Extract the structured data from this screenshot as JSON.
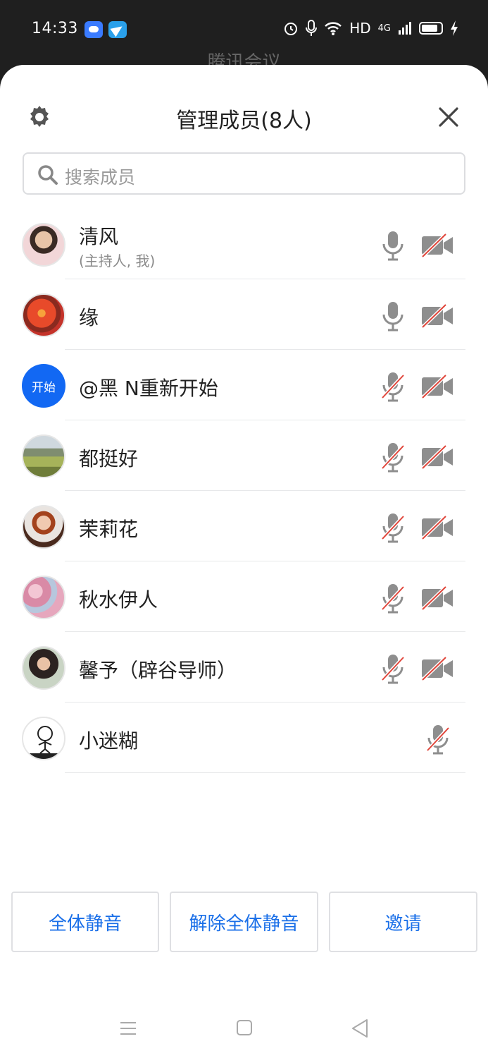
{
  "status_bar": {
    "time": "14:33",
    "right_text": "HD",
    "network": "4G",
    "icons": [
      "cloud-app-icon",
      "send-app-icon",
      "alarm-icon",
      "mic-icon",
      "wifi-icon",
      "signal-icon",
      "battery-icon",
      "charging-icon"
    ]
  },
  "behind": {
    "title": "腾讯会议"
  },
  "header": {
    "title": "管理成员(8人)"
  },
  "search": {
    "placeholder": "搜索成员"
  },
  "members": [
    {
      "name": "清风",
      "subtitle": "(主持人, 我)",
      "avatar": "photo",
      "mic_muted": false,
      "camera_off": true
    },
    {
      "name": "缘",
      "subtitle": "",
      "avatar": "photo",
      "mic_muted": false,
      "camera_off": true
    },
    {
      "name": "@黑 N重新开始",
      "subtitle": "",
      "avatar_text": "开始",
      "mic_muted": true,
      "camera_off": true
    },
    {
      "name": "都挺好",
      "subtitle": "",
      "avatar": "photo",
      "mic_muted": true,
      "camera_off": true
    },
    {
      "name": "茉莉花",
      "subtitle": "",
      "avatar": "photo",
      "mic_muted": true,
      "camera_off": true
    },
    {
      "name": "秋水伊人",
      "subtitle": "",
      "avatar": "photo",
      "mic_muted": true,
      "camera_off": true
    },
    {
      "name": "馨予（辟谷导师）",
      "subtitle": "",
      "avatar": "photo",
      "mic_muted": true,
      "camera_off": true
    },
    {
      "name": "小迷糊",
      "subtitle": "",
      "avatar": "photo",
      "mic_muted": true,
      "camera_off": null
    }
  ],
  "actions": {
    "mute_all": "全体静音",
    "unmute_all": "解除全体静音",
    "invite": "邀请"
  },
  "colors": {
    "accent": "#1a6fe8",
    "muted_slash": "#e0453a",
    "icon_gray": "#8e8e8e"
  }
}
